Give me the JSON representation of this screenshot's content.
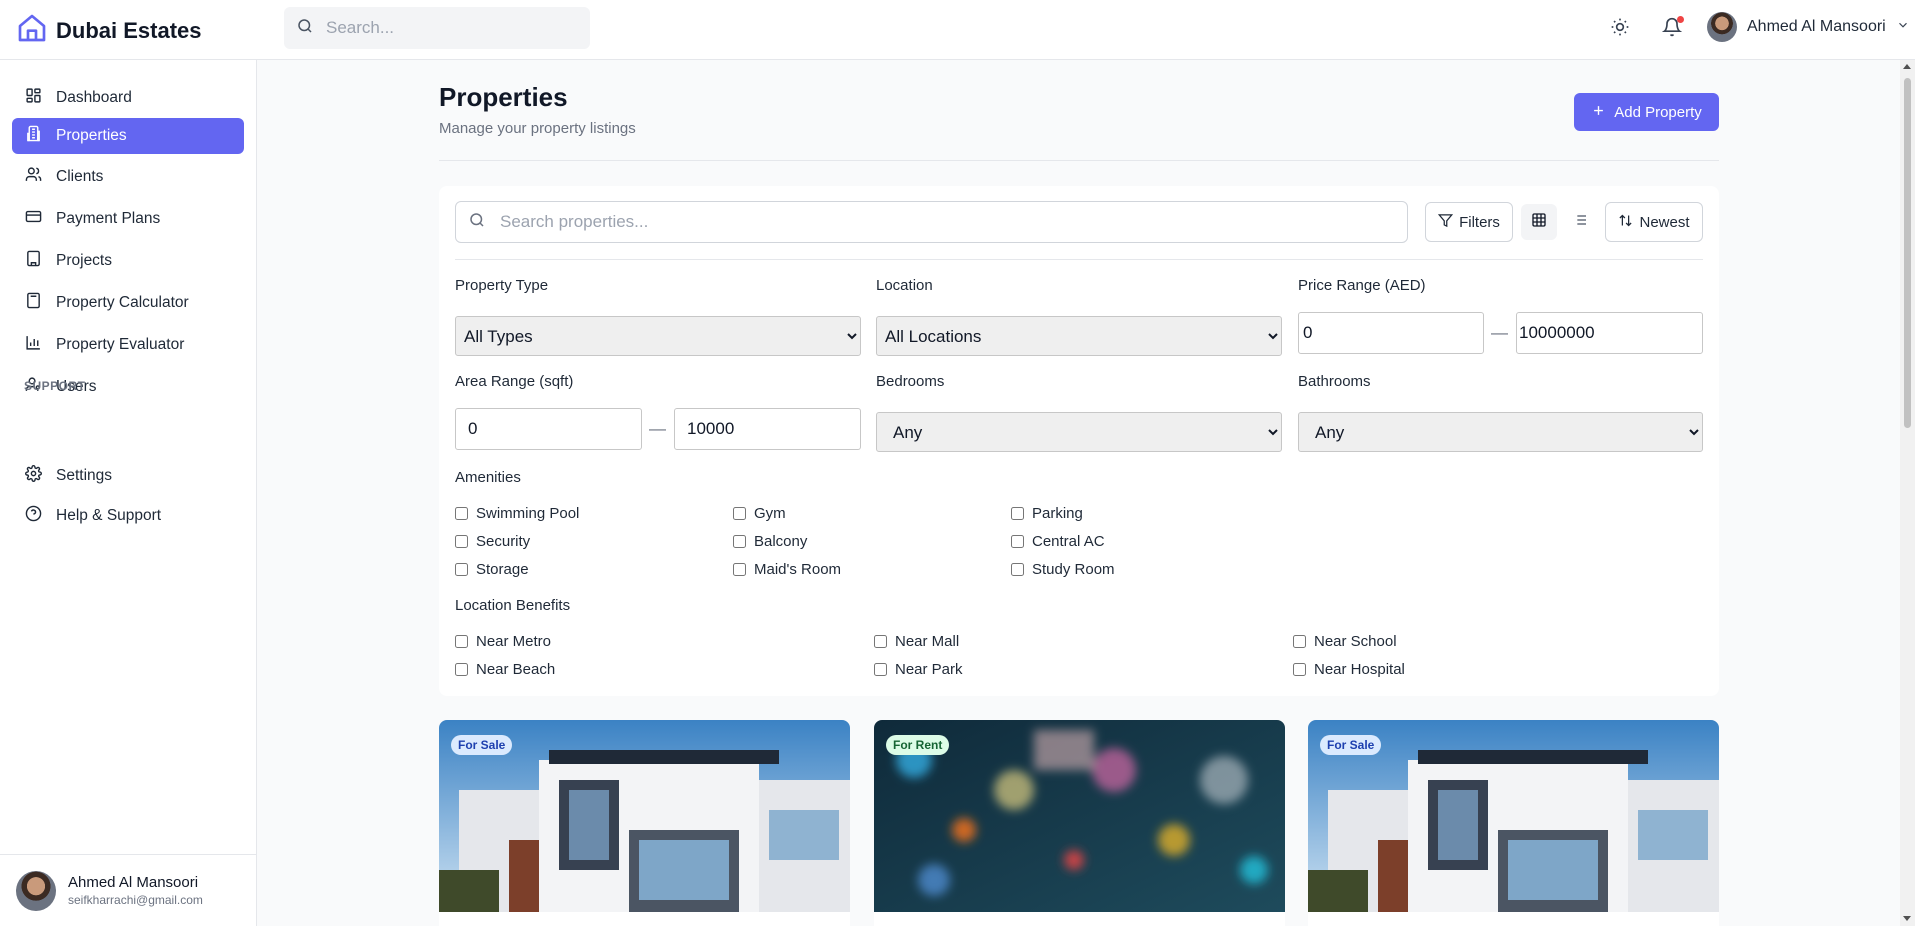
{
  "brand": {
    "title": "Dubai Estates"
  },
  "topbar": {
    "search_placeholder": "Search...",
    "user_name": "Ahmed Al Mansoori"
  },
  "sidebar": {
    "items": [
      {
        "label": "Dashboard",
        "icon": "dashboard-icon"
      },
      {
        "label": "Properties",
        "icon": "building-icon",
        "active": true
      },
      {
        "label": "Clients",
        "icon": "users-icon"
      },
      {
        "label": "Payment Plans",
        "icon": "credit-card-icon"
      },
      {
        "label": "Projects",
        "icon": "building-icon"
      },
      {
        "label": "Property Calculator",
        "icon": "calculator-icon"
      },
      {
        "label": "Property Evaluator",
        "icon": "bar-chart-icon"
      },
      {
        "label": "Users",
        "icon": "user-key-icon"
      }
    ],
    "support_label": "SUPPORT",
    "support_items": [
      {
        "label": "Settings",
        "icon": "gear-icon"
      },
      {
        "label": "Help & Support",
        "icon": "help-icon"
      }
    ],
    "footer": {
      "name": "Ahmed Al Mansoori",
      "email": "seifkharrachi@gmail.com"
    }
  },
  "page": {
    "title": "Properties",
    "subtitle": "Manage your property listings",
    "add_button": "Add Property"
  },
  "filters": {
    "search_placeholder": "Search properties...",
    "filters_button": "Filters",
    "sort_button": "Newest",
    "property_type": {
      "label": "Property Type",
      "value": "All Types"
    },
    "location": {
      "label": "Location",
      "value": "All Locations"
    },
    "price_range": {
      "label": "Price Range (AED)",
      "min": "0",
      "max": "10000000"
    },
    "area_range": {
      "label": "Area Range (sqft)",
      "min": "0",
      "max": "10000"
    },
    "bedrooms": {
      "label": "Bedrooms",
      "value": "Any"
    },
    "bathrooms": {
      "label": "Bathrooms",
      "value": "Any"
    },
    "dash": "—",
    "amenities_label": "Amenities",
    "amenities": [
      "Swimming Pool",
      "Gym",
      "Parking",
      "Security",
      "Balcony",
      "Central AC",
      "Storage",
      "Maid's Room",
      "Study Room"
    ],
    "location_benefits_label": "Location Benefits",
    "location_benefits": [
      "Near Metro",
      "Near Mall",
      "Near School",
      "Near Beach",
      "Near Park",
      "Near Hospital"
    ]
  },
  "cards": [
    {
      "badge": "For Sale",
      "type": "sale"
    },
    {
      "badge": "For Rent",
      "type": "rent"
    },
    {
      "badge": "For Sale",
      "type": "sale"
    }
  ],
  "colors": {
    "accent": "#6366f1",
    "notification": "#ef4444"
  }
}
